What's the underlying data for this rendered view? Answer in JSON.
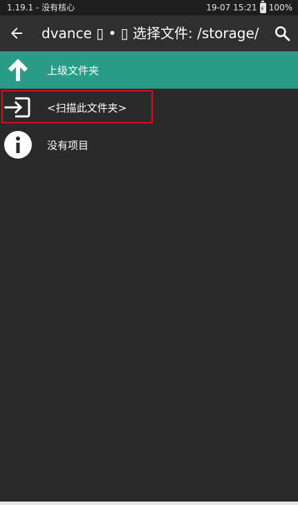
{
  "status": {
    "left_text": "1.19.1 - 没有核心",
    "time": "19-07 15:21",
    "battery": "100%"
  },
  "toolbar": {
    "title": "dvance ▯ • ▯ 选择文件: /storage/"
  },
  "list": [
    {
      "label": "上级文件夹",
      "icon": "arrow-up-icon"
    },
    {
      "label": "<扫描此文件夹>",
      "icon": "enter-icon"
    },
    {
      "label": "没有项目",
      "icon": "info-icon"
    }
  ],
  "colors": {
    "accent": "#2a9d88",
    "background": "#2a2a2a",
    "highlight": "#d3101a"
  }
}
